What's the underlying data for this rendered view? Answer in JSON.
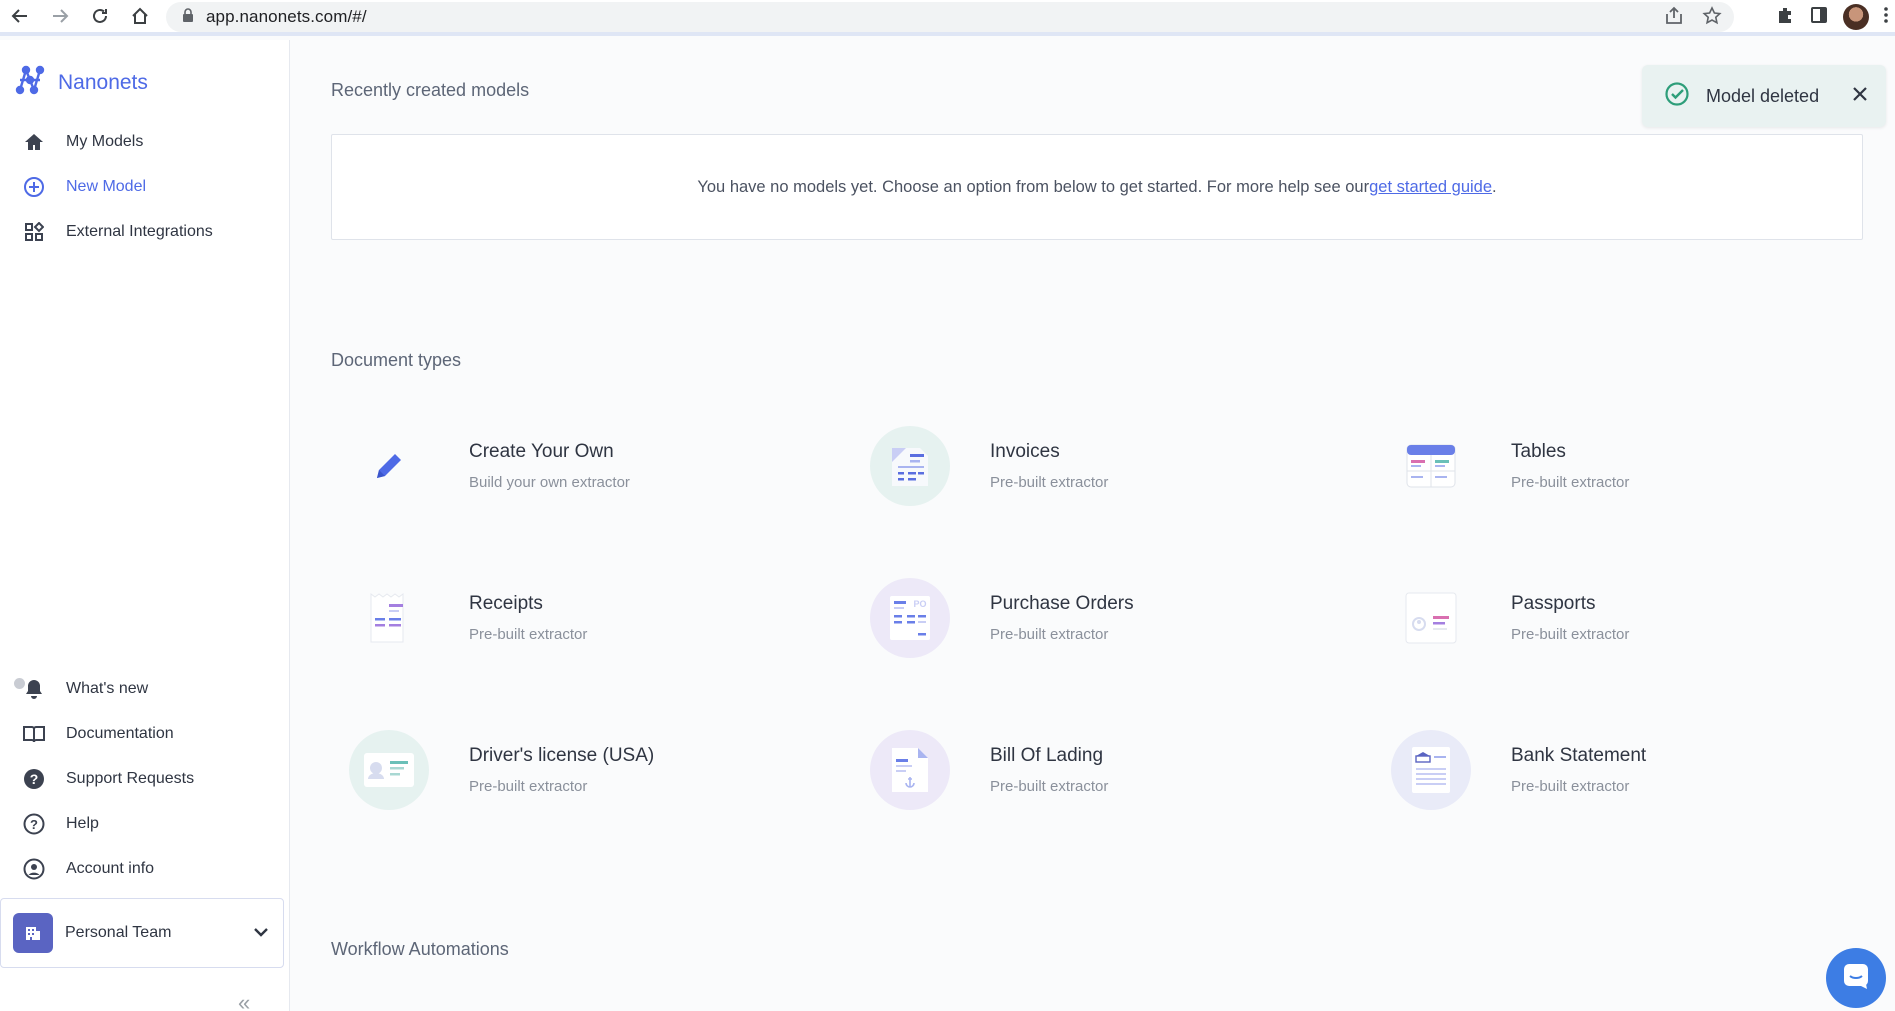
{
  "browser": {
    "url": "app.nanonets.com/#/"
  },
  "sidebar": {
    "brand": "Nanonets",
    "top_items": [
      {
        "label": "My Models",
        "icon": "home-icon"
      },
      {
        "label": "New Model",
        "icon": "plus-circle-icon"
      },
      {
        "label": "External Integrations",
        "icon": "grid-icon"
      }
    ],
    "bottom_items": [
      {
        "label": "What's new",
        "icon": "bell-icon"
      },
      {
        "label": "Documentation",
        "icon": "book-icon"
      },
      {
        "label": "Support Requests",
        "icon": "question-circle-icon"
      },
      {
        "label": "Help",
        "icon": "help-circle-icon"
      },
      {
        "label": "Account info",
        "icon": "account-icon"
      }
    ],
    "team": "Personal Team",
    "collapse": "«"
  },
  "main": {
    "recent_title": "Recently created models",
    "empty_text": "You have no models yet. Choose an option from below to get started. For more help see our ",
    "empty_link": "get started guide",
    "empty_end": ".",
    "doc_types_title": "Document types",
    "doc_types": [
      {
        "title": "Create Your Own",
        "subtitle": "Build your own extractor",
        "icon": "pencil-icon"
      },
      {
        "title": "Invoices",
        "subtitle": "Pre-built extractor",
        "icon": "invoice-icon"
      },
      {
        "title": "Tables",
        "subtitle": "Pre-built extractor",
        "icon": "table-icon"
      },
      {
        "title": "Receipts",
        "subtitle": "Pre-built extractor",
        "icon": "receipt-icon"
      },
      {
        "title": "Purchase Orders",
        "subtitle": "Pre-built extractor",
        "icon": "purchase-order-icon"
      },
      {
        "title": "Passports",
        "subtitle": "Pre-built extractor",
        "icon": "passport-icon"
      },
      {
        "title": "Driver's license (USA)",
        "subtitle": "Pre-built extractor",
        "icon": "license-icon"
      },
      {
        "title": "Bill Of Lading",
        "subtitle": "Pre-built extractor",
        "icon": "bill-of-lading-icon"
      },
      {
        "title": "Bank Statement",
        "subtitle": "Pre-built extractor",
        "icon": "bank-statement-icon"
      }
    ],
    "workflow_title": "Workflow Automations"
  },
  "toast": {
    "message": "Model deleted"
  },
  "colors": {
    "accent": "#4e6ae6",
    "toast_bg": "#e9f2f1",
    "success": "#2e9e7a"
  }
}
